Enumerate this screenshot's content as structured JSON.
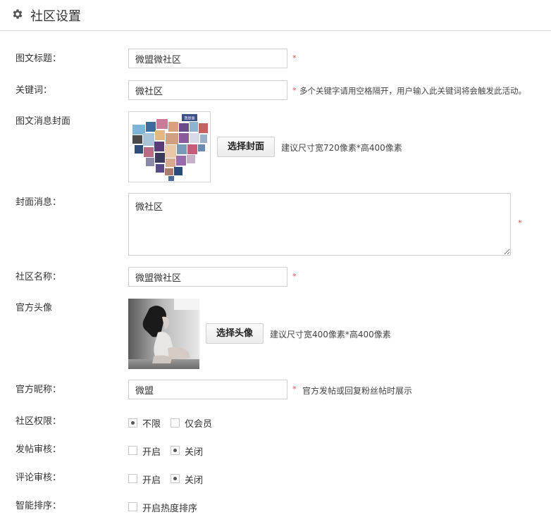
{
  "header": {
    "title": "社区设置"
  },
  "fields": {
    "title": {
      "label": "图文标题：",
      "value": "微盟微社区",
      "required": "*"
    },
    "keyword": {
      "label": "关键词：",
      "value": "微社区",
      "required": "*",
      "hint": "多个关键字请用空格隔开，用户输入此关键词将会触发此活动。"
    },
    "cover": {
      "label": "图文消息封面",
      "button": "选择封面",
      "hint": "建议尺寸宽720像素*高400像素",
      "thumb_tag": "我是谁"
    },
    "cover_msg": {
      "label": "封面消息：",
      "value": "微社区",
      "required": "*"
    },
    "community_name": {
      "label": "社区名称：",
      "value": "微盟微社区",
      "required": "*"
    },
    "official_avatar": {
      "label": "官方头像",
      "button": "选择头像",
      "hint": "建议尺寸宽400像素*高400像素"
    },
    "official_nickname": {
      "label": "官方昵称：",
      "value": "微盟",
      "required": "*",
      "hint": "官方发帖或回复粉丝帖时展示"
    },
    "permission": {
      "label": "社区权限：",
      "options": [
        "不限",
        "仅会员"
      ],
      "selected": "不限"
    },
    "post_review": {
      "label": "发帖审核：",
      "options": [
        "开启",
        "关闭"
      ],
      "selected": "关闭"
    },
    "comment_review": {
      "label": "评论审核：",
      "options": [
        "开启",
        "关闭"
      ],
      "selected": "关闭"
    },
    "smart_sort": {
      "label": "智能排序：",
      "option": "开启热度排序",
      "checked": false
    }
  },
  "colors": {
    "required": "#d9534f",
    "border": "#cfcfcf",
    "radio_dot": "#555555"
  }
}
